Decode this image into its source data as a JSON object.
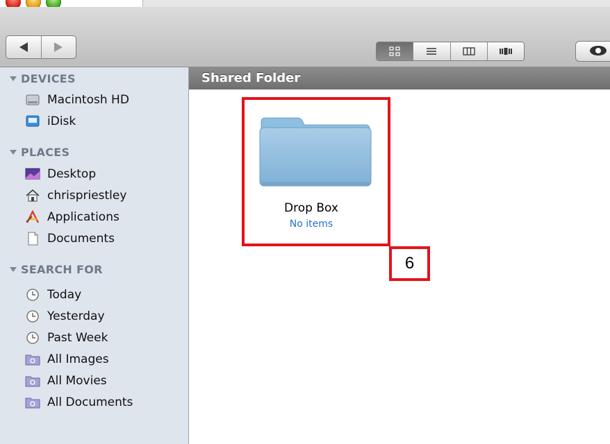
{
  "window": {
    "title_path": "Shared Folder"
  },
  "toolbar": {
    "back_icon": "back-arrow",
    "forward_icon": "forward-arrow",
    "view_modes": [
      "icon-view",
      "list-view",
      "column-view",
      "cover-flow-view"
    ],
    "active_view": "icon-view",
    "quicklook_icon": "eye"
  },
  "sidebar": {
    "sections": [
      {
        "label": "DEVICES",
        "items": [
          {
            "label": "Macintosh HD",
            "icon": "hard-disk"
          },
          {
            "label": "iDisk",
            "icon": "idisk"
          }
        ]
      },
      {
        "label": "PLACES",
        "items": [
          {
            "label": "Desktop",
            "icon": "desktop"
          },
          {
            "label": "chrispriestley",
            "icon": "home"
          },
          {
            "label": "Applications",
            "icon": "applications"
          },
          {
            "label": "Documents",
            "icon": "document"
          }
        ]
      },
      {
        "label": "SEARCH FOR",
        "items": [
          {
            "label": "Today",
            "icon": "clock"
          },
          {
            "label": "Yesterday",
            "icon": "clock"
          },
          {
            "label": "Past Week",
            "icon": "clock"
          },
          {
            "label": "All Images",
            "icon": "smart-folder"
          },
          {
            "label": "All Movies",
            "icon": "smart-folder"
          },
          {
            "label": "All Documents",
            "icon": "smart-folder"
          }
        ]
      }
    ]
  },
  "content": {
    "items": [
      {
        "name": "Drop Box",
        "subtitle": "No items",
        "icon": "folder"
      }
    ]
  },
  "annotation": {
    "callout_number": "6",
    "color": "#e4121b"
  }
}
